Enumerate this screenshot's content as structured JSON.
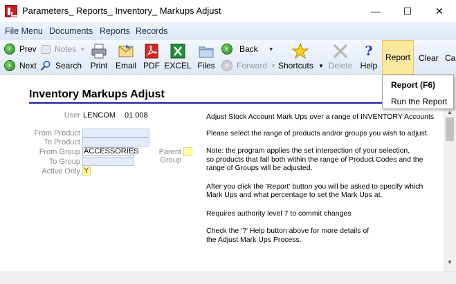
{
  "window": {
    "title": "Parameters_ Reports_ Inventory_ Markups Adjust",
    "minimize_glyph": "—",
    "maximize_glyph": "☐",
    "close_glyph": "✕"
  },
  "menu": {
    "items": [
      "File Menu",
      "Documents",
      "Reports",
      "Records"
    ]
  },
  "toolbar": {
    "prev": "Prev",
    "next": "Next",
    "notes": "Notes",
    "search": "Search",
    "print": "Print",
    "email": "Email",
    "pdf": "PDF",
    "excel": "EXCEL",
    "files": "Files",
    "back": "Back",
    "forward": "Forward",
    "shortcuts": "Shortcuts",
    "delete": "Delete",
    "help": "Help",
    "report": "Report",
    "clear": "Clear",
    "cancel_partial": "Ca"
  },
  "report_menu": {
    "items": [
      "Report (F6)",
      "Run the Report"
    ]
  },
  "form": {
    "page_title": "Inventory Markups Adjust",
    "user_label": "User",
    "user_value": "LENCOM",
    "user_code": "01 008",
    "from_product_label": "From Product",
    "from_product_value": "",
    "to_product_label": "To Product",
    "to_product_value": "",
    "from_group_label": "From Group",
    "from_group_value": "ACCESSORIES",
    "parent_group_label": "Parent Group",
    "parent_group_value": "",
    "to_group_label": "To Group",
    "to_group_value": "",
    "active_only_label": "Active Only",
    "active_only_value": "Y"
  },
  "help_text": {
    "p1": "Adjust Stock Account Mark Ups over a range of INVENTORY Accounts",
    "p2": "Please select the range of products and/or groups you wish to adjust.",
    "p3_l1": "Note: the program applies the set intersection of your selection,",
    "p3_l2": "so products that fall both within the range of Product Codes and the",
    "p3_l3": "range of Groups will be adjusted.",
    "p4_l1": "After you click the 'Report' button you will be asked to specify which",
    "p4_l2": "Mark Ups and what percentage to set the Mark Ups at.",
    "p5": "Requires authority level 7 to commit changes",
    "p6_l1": "Check the '?' Help button above for more details of",
    "p6_l2": "the Adjust Mark Ups Process."
  },
  "colors": {
    "title_rule": "#1a1aa6",
    "report_highlight": "#fbe8a0",
    "field_blue": "#e4ecfb",
    "field_yellow": "#ffffa8"
  }
}
